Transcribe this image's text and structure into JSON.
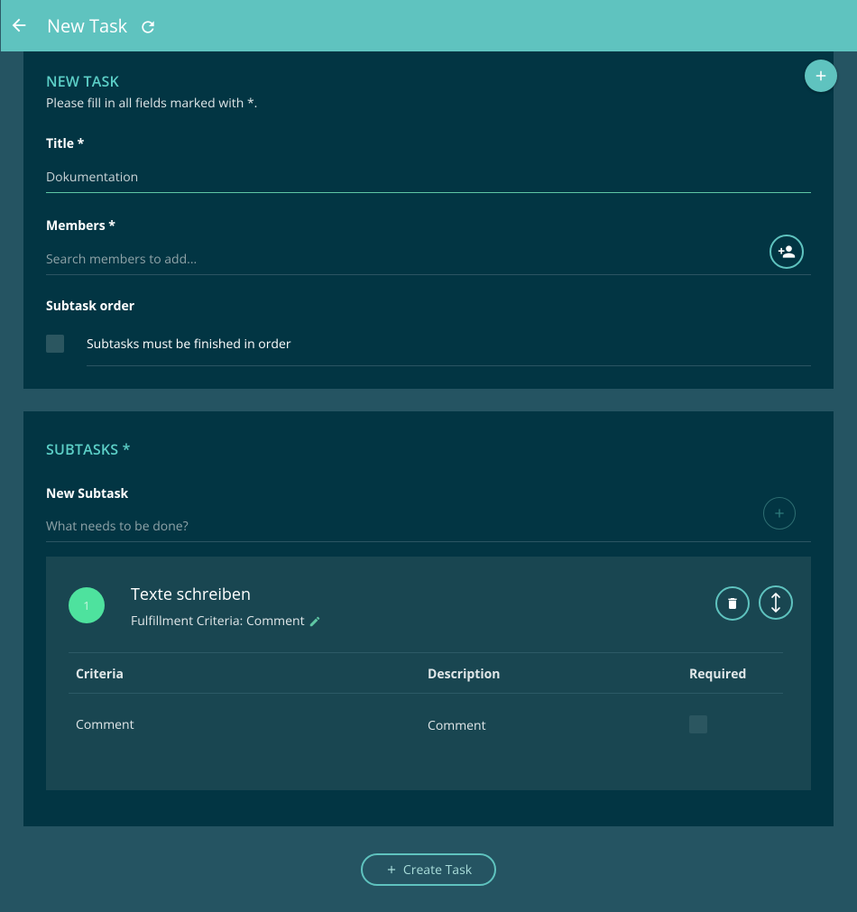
{
  "header": {
    "title": "New Task",
    "back_icon": "arrow-left-icon",
    "refresh_icon": "refresh-icon",
    "color": "#5fc3bf"
  },
  "new_task": {
    "section_title": "NEW TASK",
    "hint": "Please fill in all fields marked with *.",
    "title_label": "Title *",
    "title_value": "Dokumentation",
    "members_label": "Members *",
    "members_placeholder": "Search members to add...",
    "subtask_order_label": "Subtask order",
    "subtask_order_checkbox_label": "Subtasks must be finished in order",
    "subtask_order_checked": false
  },
  "subtasks": {
    "section_title": "SUBTASKS *",
    "new_subtask_label": "New Subtask",
    "new_subtask_placeholder": "What needs to be done?",
    "items": [
      {
        "number": "1",
        "title": "Texte schreiben",
        "subtitle": "Fulfillment Criteria: Comment",
        "table": {
          "headers": [
            "Criteria",
            "Description",
            "Required"
          ],
          "rows": [
            {
              "criteria": "Comment",
              "description": "Comment",
              "required": false
            }
          ]
        }
      }
    ]
  },
  "actions": {
    "create_label": "Create Task"
  },
  "colors": {
    "accent": "#5fc3bf",
    "background": "#255462",
    "card": "#023543",
    "subtask_card": "#194651",
    "badge": "#4ee29e"
  }
}
